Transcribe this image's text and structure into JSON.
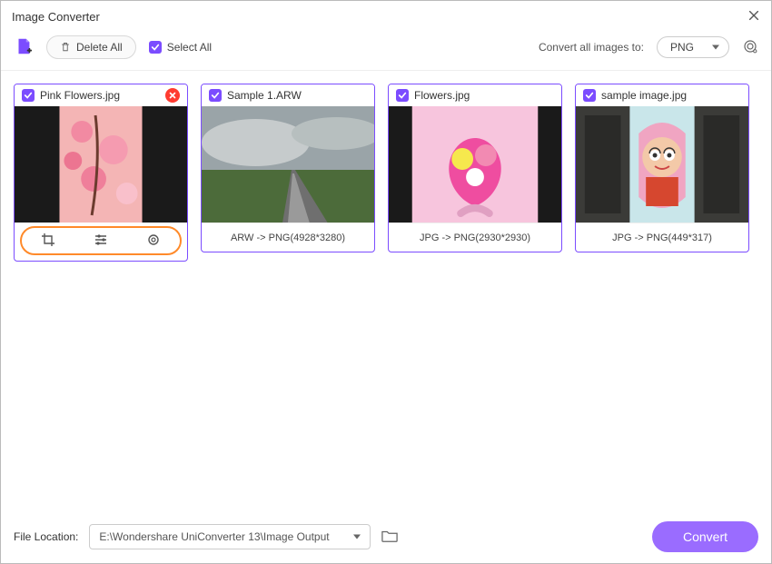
{
  "title": "Image Converter",
  "toolbar": {
    "delete_all": "Delete All",
    "select_all": "Select All",
    "convert_all_label": "Convert all images to:",
    "target_format": "PNG"
  },
  "cards": [
    {
      "filename": "Pink Flowers.jpg",
      "footer": "",
      "show_toolbar": true,
      "show_remove": true
    },
    {
      "filename": "Sample 1.ARW",
      "footer": "ARW -> PNG(4928*3280)",
      "show_toolbar": false,
      "show_remove": false
    },
    {
      "filename": "Flowers.jpg",
      "footer": "JPG -> PNG(2930*2930)",
      "show_toolbar": false,
      "show_remove": false
    },
    {
      "filename": "sample image.jpg",
      "footer": "JPG -> PNG(449*317)",
      "show_toolbar": false,
      "show_remove": false
    }
  ],
  "bottom": {
    "file_location_label": "File Location:",
    "file_location_value": "E:\\Wondershare UniConverter 13\\Image Output",
    "convert_label": "Convert"
  }
}
